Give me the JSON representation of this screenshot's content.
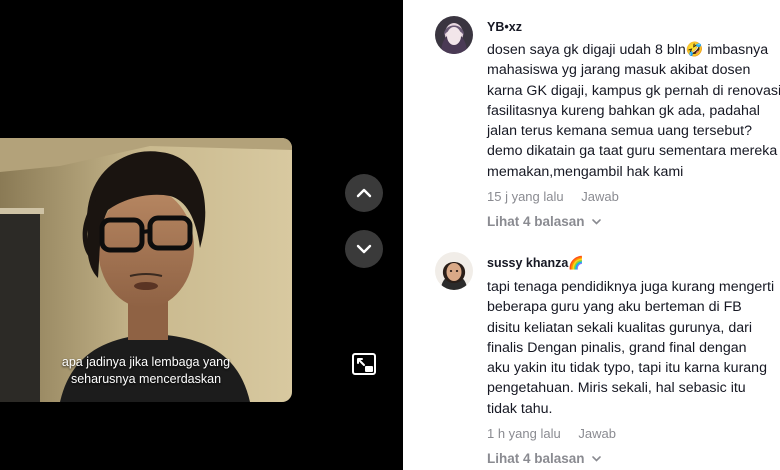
{
  "video": {
    "caption_lines": [
      "apa jadinya jika lembaga yang",
      "seharusnya mencerdaskan"
    ],
    "icons": {
      "prev": "chevron-up-icon",
      "next": "chevron-down-icon",
      "pip": "picture-in-picture-icon"
    }
  },
  "comments": [
    {
      "username": "YB•xz",
      "text_lines": [
        "dosen saya gk digaji udah 8 bln🤣 imbasnya",
        "mahasiswa yg jarang masuk akibat dosen",
        "karna GK digaji, kampus gk pernah di renovasi",
        "fasilitasnya kureng bahkan gk ada, padahal",
        "jalan terus kemana semua uang tersebut?",
        "demo dikatain ga taat guru sementara mereka",
        "memakan,mengambil hak kami"
      ],
      "time": "15 j yang lalu",
      "reply_label": "Jawab",
      "view_replies": "Lihat 4 balasan"
    },
    {
      "username": "sussy khanza🌈",
      "text_lines": [
        "tapi tenaga pendidiknya juga kurang mengerti",
        "beberapa guru yang aku berteman di FB",
        "disitu keliatan sekali kualitas gurunya, dari",
        "finalis Dengan pinalis, grand final dengan",
        "aku yakin itu tidak typo, tapi itu karna kurang",
        "pengetahuan. Miris sekali, hal sebasic itu",
        "tidak tahu."
      ],
      "time": "1 h yang lalu",
      "reply_label": "Jawab",
      "view_replies": "Lihat 4 balasan"
    }
  ]
}
